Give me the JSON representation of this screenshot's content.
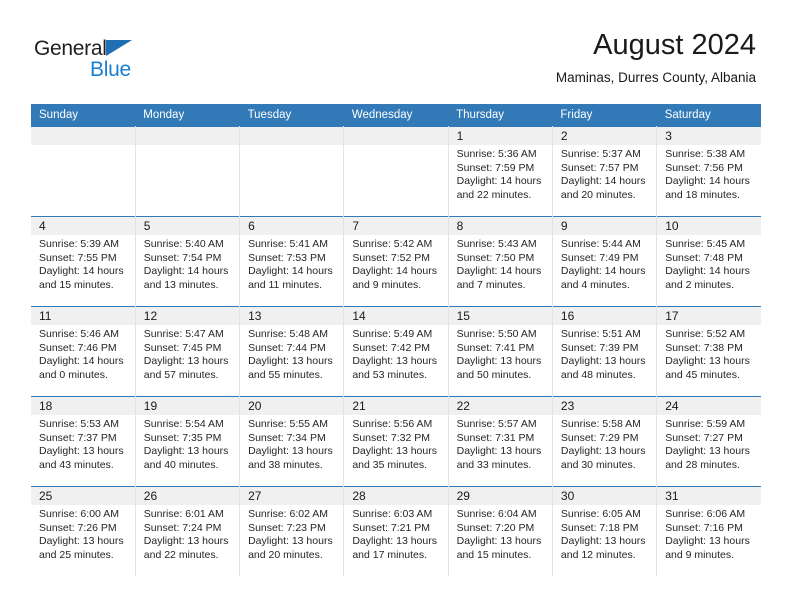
{
  "brand": {
    "name_top": "General",
    "name_bottom": "Blue",
    "accent_color": "#1a7fd4",
    "triangle_color": "#1f6fb5"
  },
  "header": {
    "title": "August 2024",
    "location": "Maminas, Durres County, Albania"
  },
  "theme": {
    "header_blue": "#3279b7",
    "daynum_band": "#f0f0f0",
    "grid_line": "#e2e2e2"
  },
  "weekday_headers": [
    "Sunday",
    "Monday",
    "Tuesday",
    "Wednesday",
    "Thursday",
    "Friday",
    "Saturday"
  ],
  "weeks": [
    [
      {
        "empty": true
      },
      {
        "empty": true
      },
      {
        "empty": true
      },
      {
        "empty": true
      },
      {
        "day": "1",
        "sunrise": "Sunrise: 5:36 AM",
        "sunset": "Sunset: 7:59 PM",
        "daylight1": "Daylight: 14 hours",
        "daylight2": "and 22 minutes."
      },
      {
        "day": "2",
        "sunrise": "Sunrise: 5:37 AM",
        "sunset": "Sunset: 7:57 PM",
        "daylight1": "Daylight: 14 hours",
        "daylight2": "and 20 minutes."
      },
      {
        "day": "3",
        "sunrise": "Sunrise: 5:38 AM",
        "sunset": "Sunset: 7:56 PM",
        "daylight1": "Daylight: 14 hours",
        "daylight2": "and 18 minutes."
      }
    ],
    [
      {
        "day": "4",
        "sunrise": "Sunrise: 5:39 AM",
        "sunset": "Sunset: 7:55 PM",
        "daylight1": "Daylight: 14 hours",
        "daylight2": "and 15 minutes."
      },
      {
        "day": "5",
        "sunrise": "Sunrise: 5:40 AM",
        "sunset": "Sunset: 7:54 PM",
        "daylight1": "Daylight: 14 hours",
        "daylight2": "and 13 minutes."
      },
      {
        "day": "6",
        "sunrise": "Sunrise: 5:41 AM",
        "sunset": "Sunset: 7:53 PM",
        "daylight1": "Daylight: 14 hours",
        "daylight2": "and 11 minutes."
      },
      {
        "day": "7",
        "sunrise": "Sunrise: 5:42 AM",
        "sunset": "Sunset: 7:52 PM",
        "daylight1": "Daylight: 14 hours",
        "daylight2": "and 9 minutes."
      },
      {
        "day": "8",
        "sunrise": "Sunrise: 5:43 AM",
        "sunset": "Sunset: 7:50 PM",
        "daylight1": "Daylight: 14 hours",
        "daylight2": "and 7 minutes."
      },
      {
        "day": "9",
        "sunrise": "Sunrise: 5:44 AM",
        "sunset": "Sunset: 7:49 PM",
        "daylight1": "Daylight: 14 hours",
        "daylight2": "and 4 minutes."
      },
      {
        "day": "10",
        "sunrise": "Sunrise: 5:45 AM",
        "sunset": "Sunset: 7:48 PM",
        "daylight1": "Daylight: 14 hours",
        "daylight2": "and 2 minutes."
      }
    ],
    [
      {
        "day": "11",
        "sunrise": "Sunrise: 5:46 AM",
        "sunset": "Sunset: 7:46 PM",
        "daylight1": "Daylight: 14 hours",
        "daylight2": "and 0 minutes."
      },
      {
        "day": "12",
        "sunrise": "Sunrise: 5:47 AM",
        "sunset": "Sunset: 7:45 PM",
        "daylight1": "Daylight: 13 hours",
        "daylight2": "and 57 minutes."
      },
      {
        "day": "13",
        "sunrise": "Sunrise: 5:48 AM",
        "sunset": "Sunset: 7:44 PM",
        "daylight1": "Daylight: 13 hours",
        "daylight2": "and 55 minutes."
      },
      {
        "day": "14",
        "sunrise": "Sunrise: 5:49 AM",
        "sunset": "Sunset: 7:42 PM",
        "daylight1": "Daylight: 13 hours",
        "daylight2": "and 53 minutes."
      },
      {
        "day": "15",
        "sunrise": "Sunrise: 5:50 AM",
        "sunset": "Sunset: 7:41 PM",
        "daylight1": "Daylight: 13 hours",
        "daylight2": "and 50 minutes."
      },
      {
        "day": "16",
        "sunrise": "Sunrise: 5:51 AM",
        "sunset": "Sunset: 7:39 PM",
        "daylight1": "Daylight: 13 hours",
        "daylight2": "and 48 minutes."
      },
      {
        "day": "17",
        "sunrise": "Sunrise: 5:52 AM",
        "sunset": "Sunset: 7:38 PM",
        "daylight1": "Daylight: 13 hours",
        "daylight2": "and 45 minutes."
      }
    ],
    [
      {
        "day": "18",
        "sunrise": "Sunrise: 5:53 AM",
        "sunset": "Sunset: 7:37 PM",
        "daylight1": "Daylight: 13 hours",
        "daylight2": "and 43 minutes."
      },
      {
        "day": "19",
        "sunrise": "Sunrise: 5:54 AM",
        "sunset": "Sunset: 7:35 PM",
        "daylight1": "Daylight: 13 hours",
        "daylight2": "and 40 minutes."
      },
      {
        "day": "20",
        "sunrise": "Sunrise: 5:55 AM",
        "sunset": "Sunset: 7:34 PM",
        "daylight1": "Daylight: 13 hours",
        "daylight2": "and 38 minutes."
      },
      {
        "day": "21",
        "sunrise": "Sunrise: 5:56 AM",
        "sunset": "Sunset: 7:32 PM",
        "daylight1": "Daylight: 13 hours",
        "daylight2": "and 35 minutes."
      },
      {
        "day": "22",
        "sunrise": "Sunrise: 5:57 AM",
        "sunset": "Sunset: 7:31 PM",
        "daylight1": "Daylight: 13 hours",
        "daylight2": "and 33 minutes."
      },
      {
        "day": "23",
        "sunrise": "Sunrise: 5:58 AM",
        "sunset": "Sunset: 7:29 PM",
        "daylight1": "Daylight: 13 hours",
        "daylight2": "and 30 minutes."
      },
      {
        "day": "24",
        "sunrise": "Sunrise: 5:59 AM",
        "sunset": "Sunset: 7:27 PM",
        "daylight1": "Daylight: 13 hours",
        "daylight2": "and 28 minutes."
      }
    ],
    [
      {
        "day": "25",
        "sunrise": "Sunrise: 6:00 AM",
        "sunset": "Sunset: 7:26 PM",
        "daylight1": "Daylight: 13 hours",
        "daylight2": "and 25 minutes."
      },
      {
        "day": "26",
        "sunrise": "Sunrise: 6:01 AM",
        "sunset": "Sunset: 7:24 PM",
        "daylight1": "Daylight: 13 hours",
        "daylight2": "and 22 minutes."
      },
      {
        "day": "27",
        "sunrise": "Sunrise: 6:02 AM",
        "sunset": "Sunset: 7:23 PM",
        "daylight1": "Daylight: 13 hours",
        "daylight2": "and 20 minutes."
      },
      {
        "day": "28",
        "sunrise": "Sunrise: 6:03 AM",
        "sunset": "Sunset: 7:21 PM",
        "daylight1": "Daylight: 13 hours",
        "daylight2": "and 17 minutes."
      },
      {
        "day": "29",
        "sunrise": "Sunrise: 6:04 AM",
        "sunset": "Sunset: 7:20 PM",
        "daylight1": "Daylight: 13 hours",
        "daylight2": "and 15 minutes."
      },
      {
        "day": "30",
        "sunrise": "Sunrise: 6:05 AM",
        "sunset": "Sunset: 7:18 PM",
        "daylight1": "Daylight: 13 hours",
        "daylight2": "and 12 minutes."
      },
      {
        "day": "31",
        "sunrise": "Sunrise: 6:06 AM",
        "sunset": "Sunset: 7:16 PM",
        "daylight1": "Daylight: 13 hours",
        "daylight2": "and 9 minutes."
      }
    ]
  ]
}
